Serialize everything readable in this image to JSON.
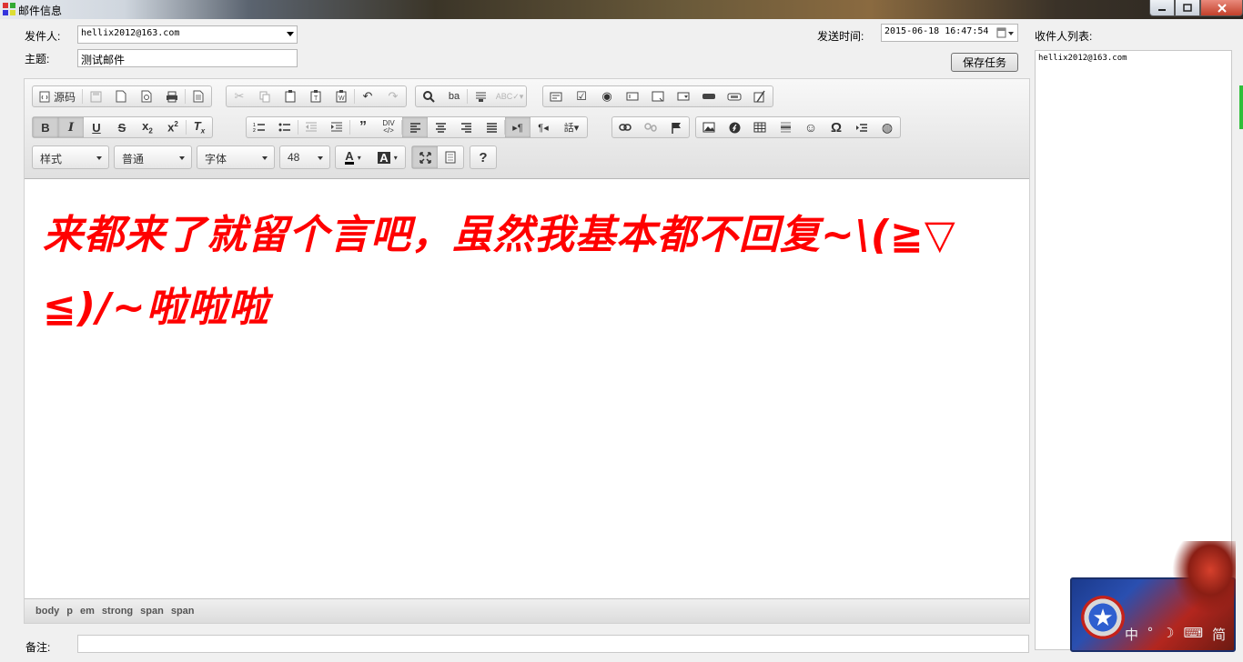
{
  "window": {
    "title": "邮件信息"
  },
  "form": {
    "sender_label": "发件人:",
    "sender_value": "hellix2012@163.com",
    "subject_label": "主题:",
    "subject_value": "测试邮件",
    "send_time_label": "发送时间:",
    "send_time_value": "2015-06-18 16:47:54",
    "save_button": "保存任务",
    "recipients_label": "收件人列表:",
    "recipients": [
      "hellix2012@163.com"
    ],
    "remark_label": "备注:"
  },
  "toolbar": {
    "source_label": "源码",
    "style_dropdown": "样式",
    "format_dropdown": "普通",
    "font_dropdown": "字体",
    "size_dropdown": "48",
    "help": "?"
  },
  "content": {
    "line1": "来都来了就留个言吧，虽然我基本都不回复~\\(≧▽",
    "line2": "≦)/~啦啦啦"
  },
  "path": [
    "body",
    "p",
    "em",
    "strong",
    "span",
    "span"
  ],
  "ime": {
    "mode": "中",
    "width": "简"
  },
  "colors": {
    "content_text": "#ff0000",
    "accent_green": "#2fbf3a"
  }
}
